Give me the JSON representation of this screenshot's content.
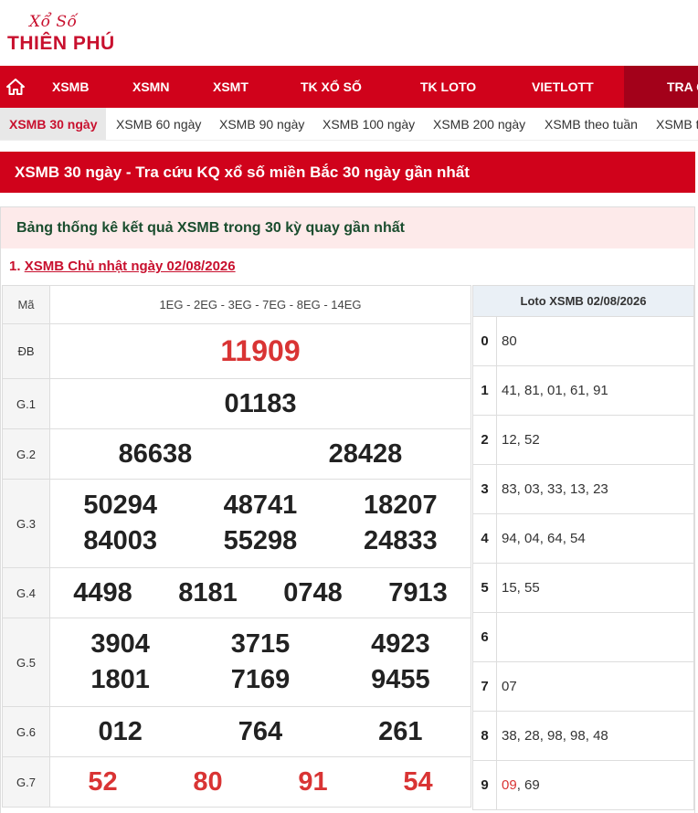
{
  "logo": {
    "top_text": "Xổ Số",
    "main_text": "THIÊN PHÚ"
  },
  "nav": {
    "items": [
      "XSMB",
      "XSMN",
      "XSMT",
      "TK XỔ SỐ",
      "TK LOTO",
      "VIETLOTT",
      "TRA C"
    ]
  },
  "subnav": {
    "items": [
      "XSMB 30 ngày",
      "XSMB 60 ngày",
      "XSMB 90 ngày",
      "XSMB 100 ngày",
      "XSMB 200 ngày",
      "XSMB theo tuần",
      "XSMB t"
    ]
  },
  "page_title": "XSMB 30 ngày - Tra cứu KQ xổ số miền Bắc 30 ngày gần nhất",
  "panel": {
    "heading": "Bảng thống kê kết quả XSMB trong 30 kỳ quay gần nhất",
    "entry_num": "1.",
    "entry_link": "XSMB Chủ nhật ngày 02/08/2026"
  },
  "results": {
    "header_label": "Mã",
    "header_codes": "1EG - 2EG - 3EG - 7EG - 8EG - 14EG",
    "rows": [
      {
        "label": "ĐB",
        "lines": [
          [
            "11909"
          ]
        ]
      },
      {
        "label": "G.1",
        "lines": [
          [
            "01183"
          ]
        ]
      },
      {
        "label": "G.2",
        "lines": [
          [
            "86638",
            "28428"
          ]
        ]
      },
      {
        "label": "G.3",
        "lines": [
          [
            "50294",
            "48741",
            "18207"
          ],
          [
            "84003",
            "55298",
            "24833"
          ]
        ]
      },
      {
        "label": "G.4",
        "lines": [
          [
            "4498",
            "8181",
            "0748",
            "7913"
          ]
        ]
      },
      {
        "label": "G.5",
        "lines": [
          [
            "3904",
            "3715",
            "4923"
          ],
          [
            "1801",
            "7169",
            "9455"
          ]
        ]
      },
      {
        "label": "G.6",
        "lines": [
          [
            "012",
            "764",
            "261"
          ]
        ]
      },
      {
        "label": "G.7",
        "lines": [
          [
            "52",
            "80",
            "91",
            "54"
          ]
        ]
      }
    ]
  },
  "loto": {
    "title": "Loto XSMB 02/08/2026",
    "rows": [
      {
        "k": "0",
        "v": "80"
      },
      {
        "k": "1",
        "v": "41, 81, 01, 61, 91"
      },
      {
        "k": "2",
        "v": "12, 52"
      },
      {
        "k": "3",
        "v": "83, 03, 33, 13, 23"
      },
      {
        "k": "4",
        "v": "94, 04, 64, 54"
      },
      {
        "k": "5",
        "v": "15, 55"
      },
      {
        "k": "6",
        "v": ""
      },
      {
        "k": "7",
        "v": "07"
      },
      {
        "k": "8",
        "v": "38, 28, 98, 98, 48"
      },
      {
        "k": "9",
        "v_red": "09",
        "v": ", 69"
      }
    ]
  },
  "colors": {
    "brand_red": "#d0021b",
    "prize_red": "#d93434"
  }
}
